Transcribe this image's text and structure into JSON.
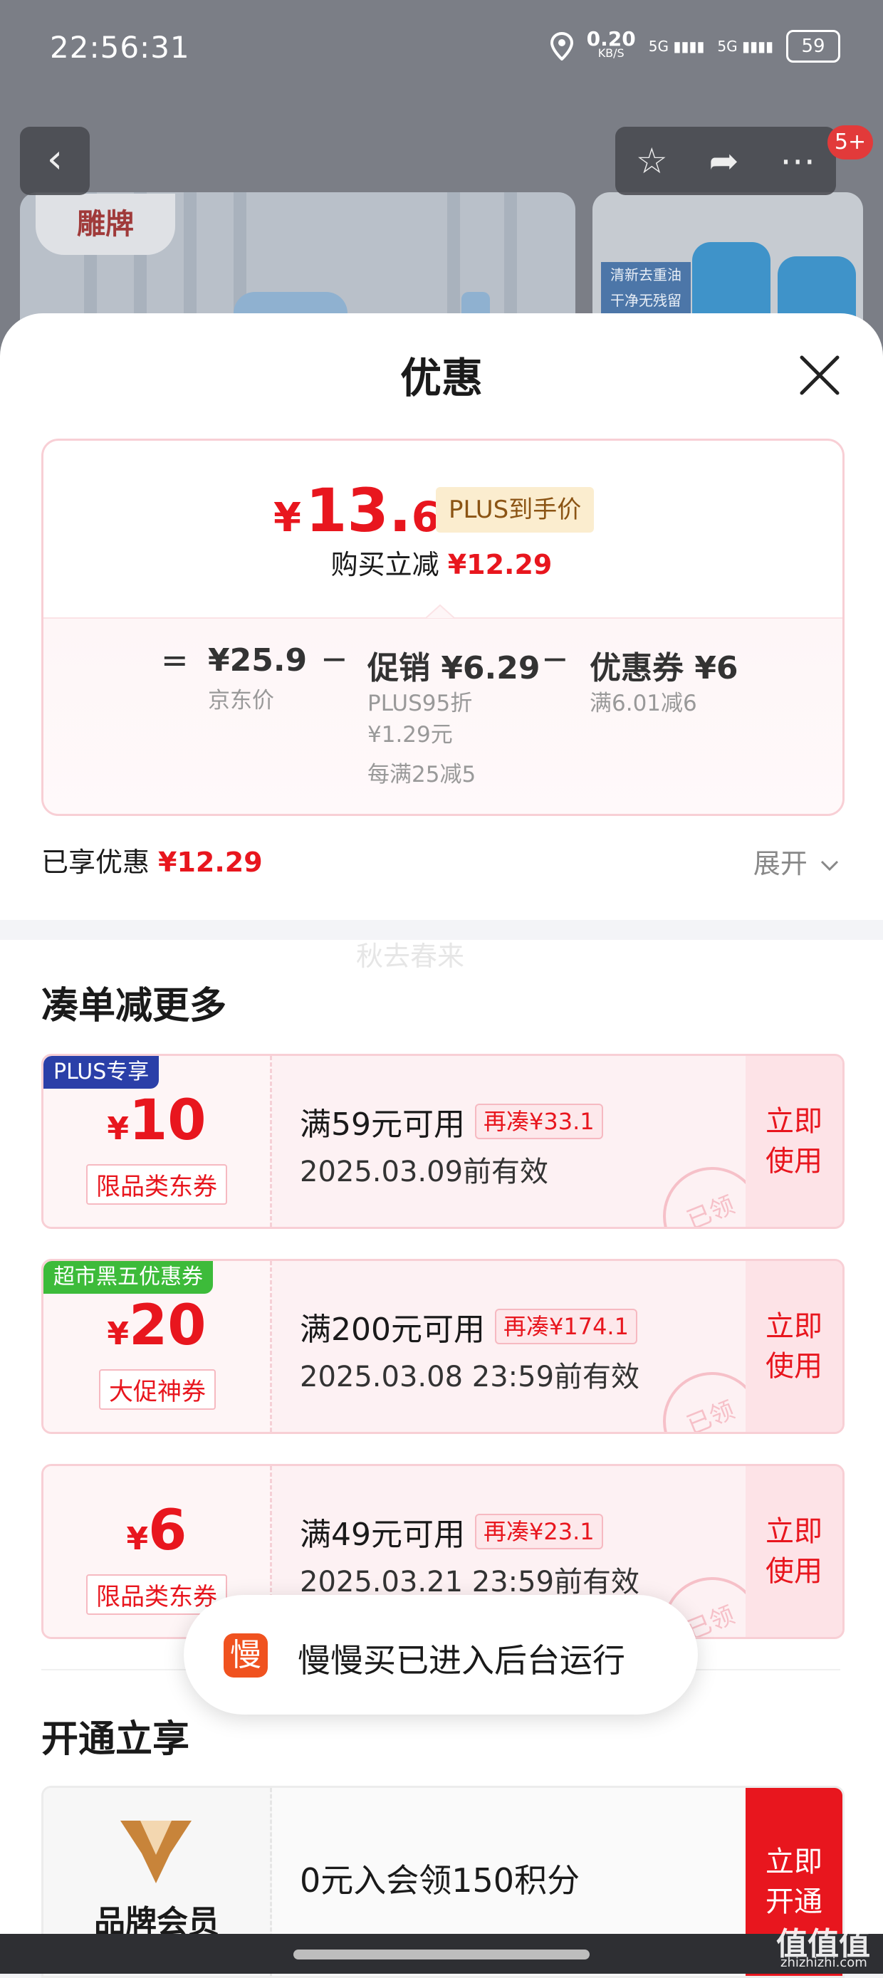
{
  "status_bar": {
    "time": "22:56:31",
    "net_speed": "0.20",
    "net_unit": "KB/S",
    "sim1": "5G",
    "sim2": "5G",
    "battery": "59"
  },
  "nav": {
    "badge": "5+"
  },
  "background_banner": {
    "logo_text": "雕牌",
    "tag_line1": "清新去重油",
    "tag_line2": "干净无残留"
  },
  "sheet": {
    "title": "优惠"
  },
  "price_card": {
    "currency": "¥",
    "price_int": "13.",
    "price_dec": "61",
    "plus_tag": "PLUS到手价",
    "reduce_label": "购买立减",
    "reduce_value": "¥12.29",
    "calc": {
      "eq": "=",
      "minus1": "−",
      "minus2": "−",
      "jd_price": "¥25.9",
      "jd_label": "京东价",
      "promo_main": "促销 ¥6.29",
      "promo_sub1": "PLUS95折",
      "promo_sub2": "¥1.29元",
      "promo_sub3": "每满25减5",
      "coupon_main": "优惠券 ¥6",
      "coupon_sub": "满6.01减6"
    }
  },
  "enjoyed": {
    "label": "已享优惠",
    "value": "¥12.29",
    "expand": "展开"
  },
  "watermark": "秋去春来",
  "section_more": {
    "title": "凑单减更多"
  },
  "coupons": [
    {
      "corner": "PLUS专享",
      "corner_color": "#2a3fa8",
      "currency": "¥",
      "amount": "10",
      "kind": "限品类东券",
      "condition": "满59元可用",
      "gap": "再凑¥33.1",
      "expiry": "2025.03.09前有效",
      "action_l1": "立即",
      "action_l2": "使用",
      "stamp": "已领"
    },
    {
      "corner": "超市黑五优惠券",
      "corner_color": "#3dbb3a",
      "currency": "¥",
      "amount": "20",
      "kind": "大促神券",
      "condition": "满200元可用",
      "gap": "再凑¥174.1",
      "expiry": "2025.03.08 23:59前有效",
      "action_l1": "立即",
      "action_l2": "使用",
      "stamp": "已领"
    },
    {
      "corner": "",
      "corner_color": "",
      "currency": "¥",
      "amount": "6",
      "kind": "限品类东券",
      "condition": "满49元可用",
      "gap": "再凑¥23.1",
      "expiry": "2025.03.21 23:59前有效",
      "action_l1": "立即",
      "action_l2": "使用",
      "stamp": "已领"
    }
  ],
  "toast": {
    "icon_char": "慢",
    "message": "慢慢买已进入后台运行"
  },
  "section_open": {
    "title": "开通立享"
  },
  "member": {
    "label": "品牌会员",
    "offer": "0元入会领150积分",
    "action_l1": "立即",
    "action_l2": "开通"
  },
  "site_watermark": {
    "name": "值值值",
    "domain": "zhizhizhi.com"
  }
}
